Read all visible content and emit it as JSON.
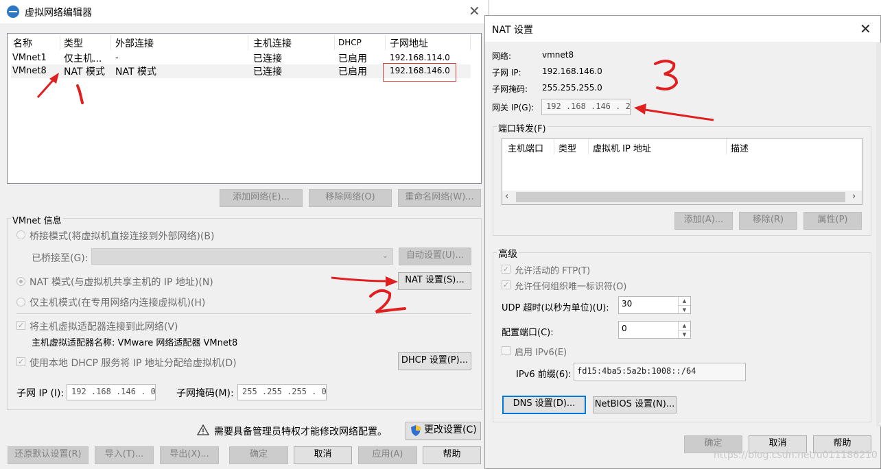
{
  "left": {
    "title": "虚拟网络编辑器",
    "table": {
      "headers": [
        "名称",
        "类型",
        "外部连接",
        "主机连接",
        "DHCP",
        "子网地址"
      ],
      "rows": [
        [
          "VMnet1",
          "仅主机...",
          "-",
          "已连接",
          "已启用",
          "192.168.114.0"
        ],
        [
          "VMnet8",
          "NAT 模式",
          "NAT 模式",
          "已连接",
          "已启用",
          "192.168.146.0"
        ]
      ]
    },
    "buttons": {
      "add": "添加网络(E)...",
      "remove": "移除网络(O)",
      "rename": "重命名网络(W)..."
    },
    "vmnet_info": {
      "group_label": "VMnet 信息",
      "bridge_radio": "桥接模式(将虚拟机直接连接到外部网络)(B)",
      "bridged_to_label": "已桥接至(G):",
      "auto_settings": "自动设置(U)...",
      "nat_radio": "NAT 模式(与虚拟机共享主机的 IP 地址)(N)",
      "nat_settings": "NAT 设置(S)...",
      "hostonly_radio": "仅主机模式(在专用网络内连接虚拟机)(H)",
      "connect_adapter": "将主机虚拟适配器连接到此网络(V)",
      "adapter_name": "主机虚拟适配器名称: VMware 网络适配器 VMnet8",
      "use_dhcp": "使用本地 DHCP 服务将 IP 地址分配给虚拟机(D)",
      "dhcp_settings": "DHCP 设置(P)...",
      "subnet_ip_label": "子网 IP (I):",
      "subnet_ip": "192 .168 .146 .  0",
      "subnet_mask_label": "子网掩码(M):",
      "subnet_mask": "255 .255 .255 .  0"
    },
    "admin_notice": "需要具备管理员特权才能修改网络配置。",
    "change_settings": "更改设置(C)",
    "bottom": {
      "restore": "还原默认设置(R)",
      "import": "导入(T)...",
      "export": "导出(X)...",
      "ok": "确定",
      "cancel": "取消",
      "apply": "应用(A)",
      "help": "帮助"
    }
  },
  "nat": {
    "title": "NAT 设置",
    "network_label": "网络:",
    "network": "vmnet8",
    "subnet_ip_label": "子网 IP:",
    "subnet_ip": "192.168.146.0",
    "subnet_mask_label": "子网掩码:",
    "subnet_mask": "255.255.255.0",
    "gateway_label": "网关 IP(G):",
    "gateway": "192 .168 .146 .  2",
    "port_forward_label": "端口转发(F)",
    "pf_headers": [
      "主机端口",
      "类型",
      "虚拟机 IP 地址",
      "描述"
    ],
    "pf_buttons": {
      "add": "添加(A)...",
      "remove": "移除(R)",
      "props": "属性(P)"
    },
    "advanced_label": "高级",
    "allow_ftp": "允许活动的 FTP(T)",
    "allow_org": "允许任何组织唯一标识符(O)",
    "udp_label": "UDP 超时(以秒为单位)(U):",
    "udp_value": "30",
    "config_port_label": "配置端口(C):",
    "config_port_value": "0",
    "ipv6_enable": "启用 IPv6(E)",
    "ipv6_prefix_label": "IPv6 前缀(6):",
    "ipv6_prefix": "fd15:4ba5:5a2b:1008::/64",
    "dns": "DNS 设置(D)...",
    "netbios": "NetBIOS 设置(N)...",
    "ok": "确定",
    "cancel": "取消",
    "help": "帮助"
  },
  "annotations": [
    "1",
    "2",
    "3"
  ],
  "watermark": "https://blog.csdn.net/u011186210",
  "colors": {
    "annotation_red": "#e02020",
    "accent": "#0078d7"
  }
}
